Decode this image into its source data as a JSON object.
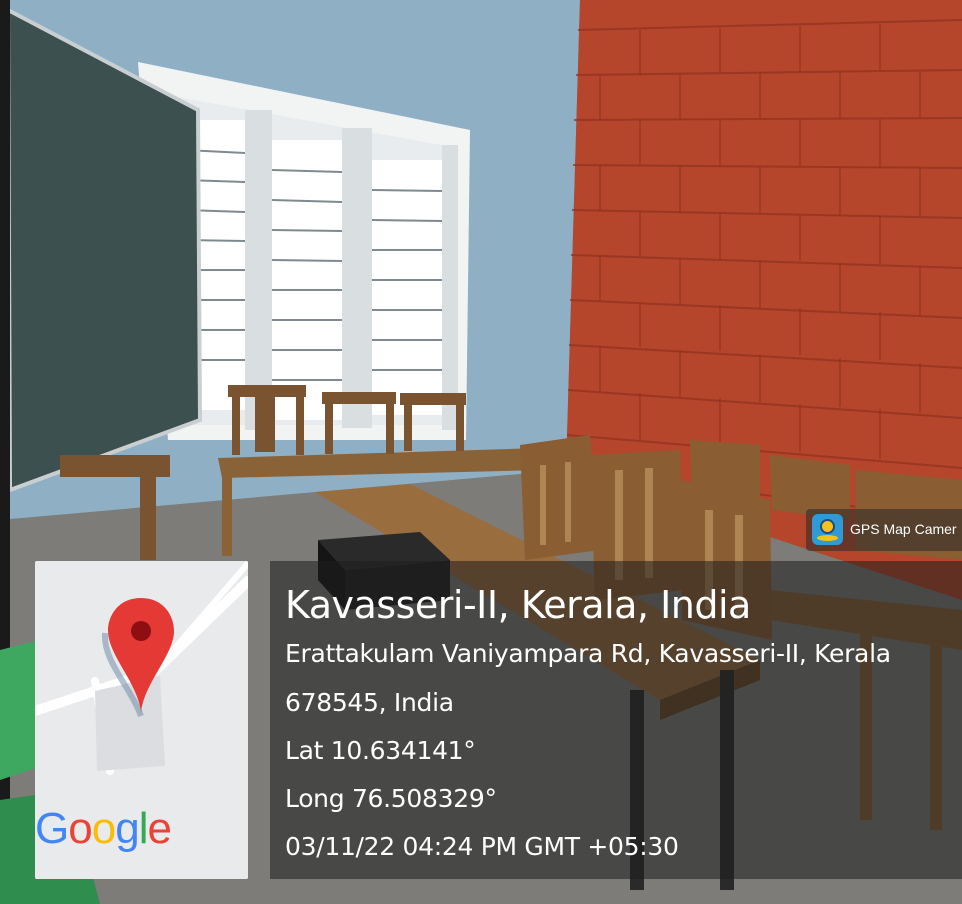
{
  "photo": {
    "scene": "classroom-photo",
    "colors": {
      "wall": "#8fb0c4",
      "brick": "#b5452b",
      "board": "#3c5050",
      "wood": "#8a6238",
      "floor": "#7d7c78"
    }
  },
  "app_badge": {
    "label": "GPS Map Camer",
    "icon": "gps-map-camera-icon"
  },
  "map_thumbnail": {
    "icon": "map-pin-icon",
    "pin_color": "#e53935",
    "logo_letters": [
      {
        "char": "G",
        "color": "#4285f4"
      },
      {
        "char": "o",
        "color": "#ea4335"
      },
      {
        "char": "o",
        "color": "#fbbc05"
      },
      {
        "char": "g",
        "color": "#4285f4"
      },
      {
        "char": "l",
        "color": "#34a853"
      },
      {
        "char": "e",
        "color": "#ea4335"
      }
    ]
  },
  "location": {
    "title": "Kavasseri-II, Kerala, India",
    "address_line1": "Erattakulam Vaniyampara Rd, Kavasseri-II, Kerala",
    "address_line2": "678545, India",
    "lat": "Lat 10.634141°",
    "long": "Long 76.508329°",
    "datetime": "03/11/22 04:24 PM GMT +05:30"
  }
}
